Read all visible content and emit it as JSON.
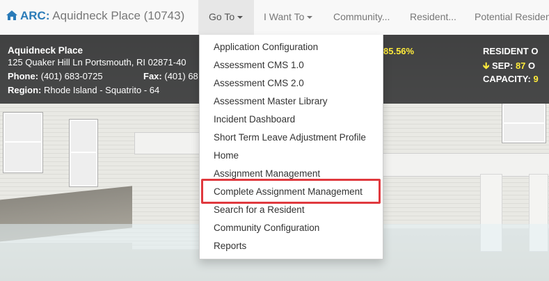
{
  "brand": {
    "prefix": "ARC:",
    "name": "Aquidneck Place (10743)"
  },
  "nav": {
    "goto": "Go To",
    "iwant": "I Want To",
    "community": "Community...",
    "resident": "Resident...",
    "potential": "Potential Residen"
  },
  "community_info": {
    "name": "Aquidneck Place",
    "address": "125 Quaker Hill Ln Portsmouth, RI 02871-40",
    "phone_label": "Phone:",
    "phone": "(401) 683-0725",
    "fax_label": "Fax:",
    "fax": "(401) 68",
    "region_label": "Region:",
    "region": "Rhode Island - Squatrito - 64",
    "occupancy": "85.56%",
    "resident_label": "RESIDENT O",
    "sep_label": "SEP:",
    "sep_value": "87",
    "sep_suffix": "O",
    "capacity_label": "CAPACITY:",
    "capacity_value": "9"
  },
  "dropdown": {
    "items": [
      "Application Configuration",
      "Assessment CMS 1.0",
      "Assessment CMS 2.0",
      "Assessment Master Library",
      "Incident Dashboard",
      "Short Term Leave Adjustment Profile",
      "Home",
      "Assignment Management",
      "Complete Assignment Management",
      "Search for a Resident",
      "Community Configuration",
      "Reports"
    ],
    "highlighted": "Complete Assignment Management"
  },
  "colors": {
    "brand": "#2a7bb8",
    "highlight": "#e0393e",
    "accent_text": "#ffeb3b"
  },
  "icons": {
    "home": "home-icon",
    "caret": "caret-down-icon",
    "arrow": "arrow-down-icon"
  }
}
